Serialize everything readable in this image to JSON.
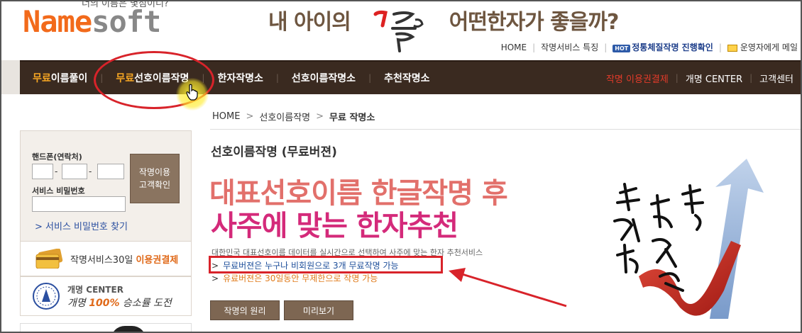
{
  "header": {
    "tagline": "너의 이름은 몇점이니?",
    "logo_part1": "Name",
    "logo_part2": "soft",
    "headline_left": "내 아이의",
    "headline_right": "어떤한자가 좋을까?"
  },
  "utility_links": {
    "home": "HOME",
    "features": "작명서비스 특징",
    "hot_badge": "HOT",
    "progress_check": "정통체질작명 진행확인",
    "contact": "운영자에게 메일"
  },
  "nav": {
    "items": [
      {
        "highlight": "무료",
        "rest": "이름풀이"
      },
      {
        "highlight": "무료",
        "rest": "선호이름작명"
      },
      {
        "highlight": "",
        "rest": "한자작명소"
      },
      {
        "highlight": "",
        "rest": "선호이름작명소"
      },
      {
        "highlight": "",
        "rest": "추천작명소"
      }
    ],
    "right": {
      "payment": "작명 이용권결제",
      "rename_center": "개명 CENTER",
      "support": "고객센터"
    }
  },
  "breadcrumb": {
    "home": "HOME",
    "level1": "선호이름작명",
    "current": "무료 작명소"
  },
  "login": {
    "phone_label": "핸드폰(연락처)",
    "phone1": "",
    "phone2": "",
    "phone3": "",
    "dash": "-",
    "password_label": "서비스 비밀번호",
    "password": "",
    "confirm_line1": "작명이용",
    "confirm_line2": "고객확인",
    "find_password": "> 서비스 비밀번호 찾기"
  },
  "side_banners": {
    "pass_text": "작명서비스30일 ",
    "pass_highlight": "이용권결제",
    "center_title": "개명 CENTER",
    "center_sub_prefix": "개명 ",
    "center_sub_pct": "100%",
    "center_sub_suffix": " 승소률 도전"
  },
  "main": {
    "section_title": "선호이름작명 (무료버젼)",
    "hero_line1": "대표선호이름 한글작명 후",
    "hero_line2": "사주에 맞는 한자추천",
    "description": "대한민국 대표선호이름 데이터를 실시간으로 선택하여 사주에 맞는 한자 추천서비스",
    "bullet1": "무료버젼은 누구나 비회원으로 3개 무료작명 가능",
    "bullet2": "유료버젼은 30일동안 무제한으로 작명 가능",
    "bullet_marker": ">",
    "button_principle": "작명의 원리",
    "button_preview": "미리보기"
  },
  "colors": {
    "nav_bg": "#3a2a20",
    "accent_orange": "#f5a623",
    "annotation_red": "#d8232a",
    "hero_pink": "#e2706b",
    "hero_magenta": "#d42a7a",
    "link_blue": "#1d4e9a"
  }
}
